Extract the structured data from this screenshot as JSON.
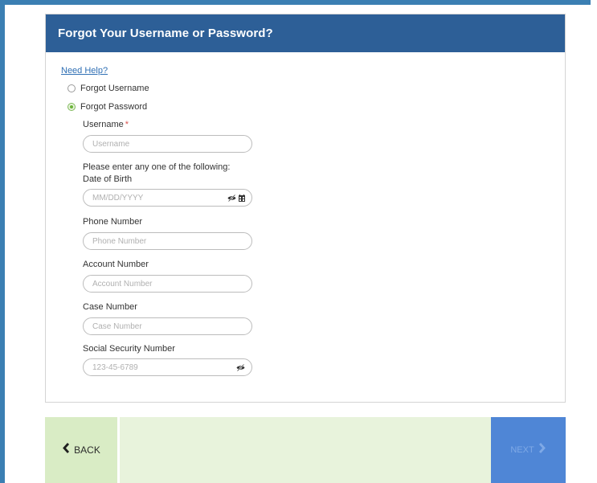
{
  "colors": {
    "frame": "#3b7fb3",
    "header_bg": "#2d5f97",
    "link": "#2f6fb4",
    "radio_selected": "#6bb43a",
    "required": "#d9534f",
    "footer_bg": "#e8f3dc",
    "back_bg": "#d9ecc5",
    "next_bg": "#4f86d6"
  },
  "header": {
    "title": "Forgot Your Username or Password?"
  },
  "help": {
    "link_label": "Need Help?"
  },
  "options": [
    {
      "label": "Forgot Username",
      "selected": false
    },
    {
      "label": "Forgot Password",
      "selected": true
    }
  ],
  "form": {
    "username": {
      "label": "Username",
      "required_mark": "*",
      "placeholder": "Username",
      "value": ""
    },
    "instructions": "Please enter any one of the following:",
    "dob": {
      "label": "Date of Birth",
      "placeholder": "MM/DD/YYYY",
      "value": "",
      "icons": [
        "eye-slash-icon",
        "calendar-icon"
      ]
    },
    "phone": {
      "label": "Phone Number",
      "placeholder": "Phone Number",
      "value": ""
    },
    "account": {
      "label": "Account Number",
      "placeholder": "Account Number",
      "value": ""
    },
    "case": {
      "label": "Case Number",
      "placeholder": "Case Number",
      "value": ""
    },
    "ssn": {
      "label": "Social Security Number",
      "placeholder": "123-45-6789",
      "value": "",
      "icons": [
        "eye-slash-icon"
      ]
    }
  },
  "footer": {
    "back_label": "BACK",
    "back_icon": "chevron-left-icon",
    "next_label": "NEXT",
    "next_icon": "chevron-right-icon"
  }
}
